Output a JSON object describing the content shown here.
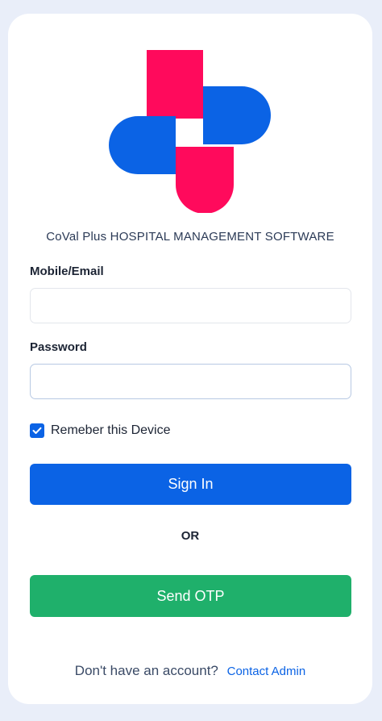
{
  "brand": {
    "title": "CoVal Plus HOSPITAL MANAGEMENT SOFTWARE",
    "logo_icon": "medical-cross-logo",
    "logo_colors": {
      "red": "#ff0a5c",
      "blue": "#0b63e5"
    }
  },
  "form": {
    "mobile_label": "Mobile/Email",
    "mobile_value": "",
    "password_label": "Password",
    "password_value": "",
    "remember_label": "Remeber this Device",
    "remember_checked": true,
    "signin_label": "Sign In",
    "or_label": "OR",
    "otp_label": "Send OTP"
  },
  "footer": {
    "text": "Don't have an account?",
    "link_label": "Contact Admin"
  },
  "colors": {
    "primary": "#0b63e5",
    "success": "#1fb06b",
    "background": "#e9eef9"
  }
}
